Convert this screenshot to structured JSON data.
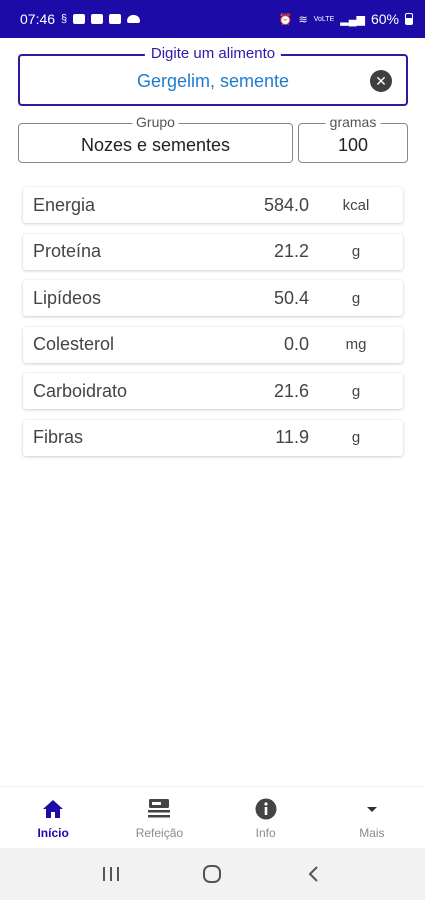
{
  "status_bar": {
    "time": "07:46",
    "battery": "60%",
    "network": "VoLTE"
  },
  "search": {
    "label": "Digite um alimento",
    "value": "Gergelim, semente",
    "clear_icon": "close-circle-icon"
  },
  "group": {
    "label": "Grupo",
    "value": "Nozes e sementes"
  },
  "grams": {
    "label": "gramas",
    "value": "100"
  },
  "nutrients": [
    {
      "name": "Energia",
      "value": "584.0",
      "unit": "kcal"
    },
    {
      "name": "Proteína",
      "value": "21.2",
      "unit": "g"
    },
    {
      "name": "Lipídeos",
      "value": "50.4",
      "unit": "g"
    },
    {
      "name": "Colesterol",
      "value": "0.0",
      "unit": "mg"
    },
    {
      "name": "Carboidrato",
      "value": "21.6",
      "unit": "g"
    },
    {
      "name": "Fibras",
      "value": "11.9",
      "unit": "g"
    }
  ],
  "bottom_nav": [
    {
      "label": "Início",
      "icon": "home-icon",
      "active": true
    },
    {
      "label": "Refeição",
      "icon": "meal-tray-icon",
      "active": false
    },
    {
      "label": "Info",
      "icon": "info-icon",
      "active": false
    },
    {
      "label": "Mais",
      "icon": "dropdown-icon",
      "active": false
    }
  ],
  "colors": {
    "primary": "#1d0ba8",
    "search_text": "#1f7ccc",
    "inactive_nav": "#8a8a8a"
  }
}
